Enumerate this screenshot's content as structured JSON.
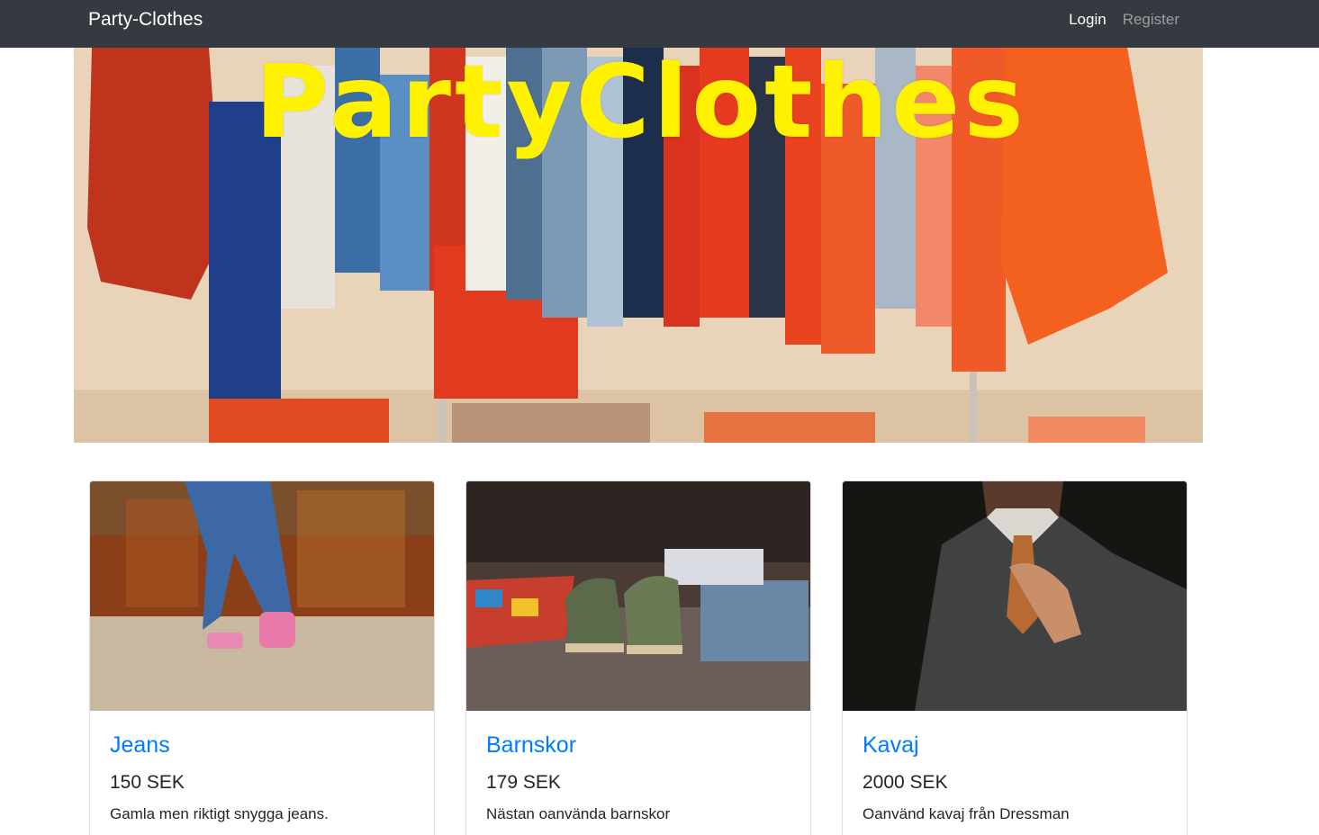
{
  "navbar": {
    "brand": "Party-Clothes",
    "links": [
      {
        "label": "Login"
      },
      {
        "label": "Register"
      }
    ]
  },
  "hero": {
    "title": "PartyClothes"
  },
  "products": [
    {
      "title": "Jeans",
      "price": "150 SEK",
      "description": "Gamla men riktigt snygga jeans."
    },
    {
      "title": "Barnskor",
      "price": "179 SEK",
      "description": "Nästan oanvända barnskor"
    },
    {
      "title": "Kavaj",
      "price": "2000 SEK",
      "description": "Oanvänd kavaj från Dressman"
    }
  ],
  "colors": {
    "navbar_bg": "#343a40",
    "link_blue": "#007bff",
    "hero_title": "#fff200"
  }
}
